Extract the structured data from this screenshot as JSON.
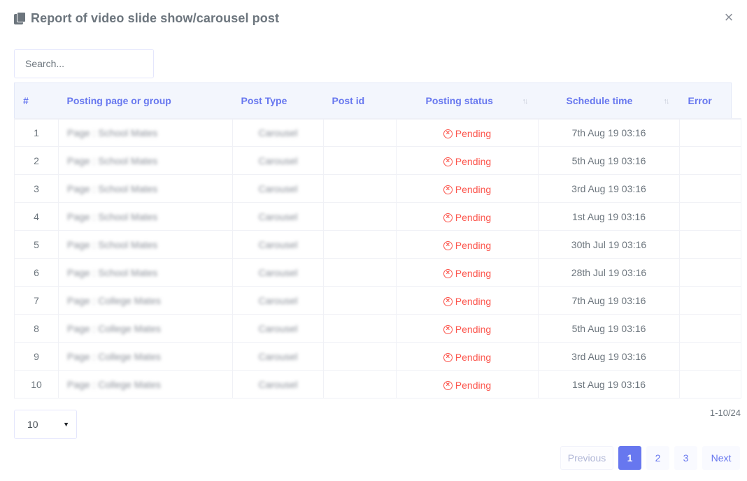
{
  "modal": {
    "title": "Report of video slide show/carousel post",
    "close_glyph": "×",
    "icon": "copy-icon"
  },
  "search": {
    "placeholder": "Search..."
  },
  "table": {
    "headers": [
      "#",
      "Posting page or group",
      "Post Type",
      "Post id",
      "Posting status",
      "Schedule time",
      "Error"
    ],
    "rows": [
      {
        "num": "1",
        "page": "Page : School Mates",
        "type": "Carousel",
        "post_id": "",
        "status": "Pending",
        "time": "7th Aug 19 03:16",
        "error": ""
      },
      {
        "num": "2",
        "page": "Page : School Mates",
        "type": "Carousel",
        "post_id": "",
        "status": "Pending",
        "time": "5th Aug 19 03:16",
        "error": ""
      },
      {
        "num": "3",
        "page": "Page : School Mates",
        "type": "Carousel",
        "post_id": "",
        "status": "Pending",
        "time": "3rd Aug 19 03:16",
        "error": ""
      },
      {
        "num": "4",
        "page": "Page : School Mates",
        "type": "Carousel",
        "post_id": "",
        "status": "Pending",
        "time": "1st Aug 19 03:16",
        "error": ""
      },
      {
        "num": "5",
        "page": "Page : School Mates",
        "type": "Carousel",
        "post_id": "",
        "status": "Pending",
        "time": "30th Jul 19 03:16",
        "error": ""
      },
      {
        "num": "6",
        "page": "Page : School Mates",
        "type": "Carousel",
        "post_id": "",
        "status": "Pending",
        "time": "28th Jul 19 03:16",
        "error": ""
      },
      {
        "num": "7",
        "page": "Page : College Mates",
        "type": "Carousel",
        "post_id": "",
        "status": "Pending",
        "time": "7th Aug 19 03:16",
        "error": ""
      },
      {
        "num": "8",
        "page": "Page : College Mates",
        "type": "Carousel",
        "post_id": "",
        "status": "Pending",
        "time": "5th Aug 19 03:16",
        "error": ""
      },
      {
        "num": "9",
        "page": "Page : College Mates",
        "type": "Carousel",
        "post_id": "",
        "status": "Pending",
        "time": "3rd Aug 19 03:16",
        "error": ""
      },
      {
        "num": "10",
        "page": "Page : College Mates",
        "type": "Carousel",
        "post_id": "",
        "status": "Pending",
        "time": "1st Aug 19 03:16",
        "error": ""
      }
    ]
  },
  "length_select": {
    "value": "10"
  },
  "info": "1-10/24",
  "pagination": {
    "previous": "Previous",
    "pages": [
      "1",
      "2",
      "3"
    ],
    "active_page": "1",
    "next": "Next"
  },
  "colors": {
    "accent": "#6777ef",
    "pending": "#fc544b",
    "title": "#6c757d"
  }
}
